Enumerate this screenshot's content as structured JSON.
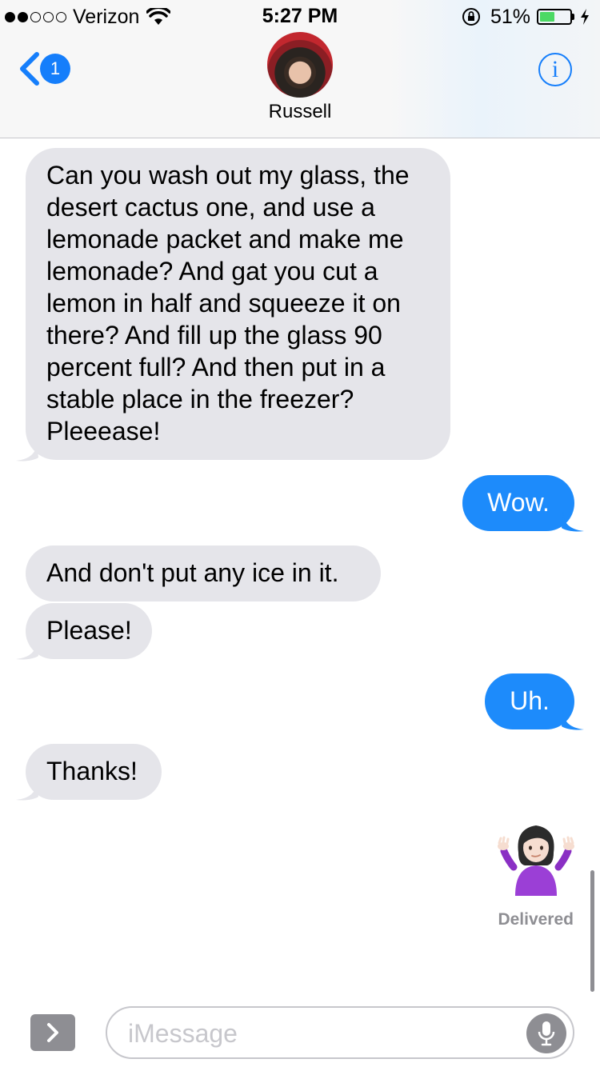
{
  "status_bar": {
    "carrier": "Verizon",
    "signal_bars_filled": 2,
    "signal_bars_total": 5,
    "time": "5:27 PM",
    "battery_percent": "51%",
    "battery_level": 0.51,
    "battery_color": "#4cd964"
  },
  "header": {
    "back_badge_count": "1",
    "contact_name": "Russell",
    "info_icon": "info-icon",
    "accent_color": "#157efb"
  },
  "messages": [
    {
      "direction": "incoming",
      "text": "Can you wash out my glass, the desert cactus one, and use a lemonade packet and make me lemonade? And gat you cut a lemon in half and squeeze it on there? And fill up the glass 90 percent full? And then put in a stable place in the freezer? Pleeease!"
    },
    {
      "direction": "outgoing",
      "text": "Wow."
    },
    {
      "direction": "incoming",
      "text": "And don't put any ice in it."
    },
    {
      "direction": "incoming",
      "text": "Please!"
    },
    {
      "direction": "outgoing",
      "text": "Uh."
    },
    {
      "direction": "incoming",
      "text": "Thanks!"
    },
    {
      "direction": "outgoing",
      "type": "emoji",
      "icon": "person-shrugging-emoji"
    }
  ],
  "delivery_status": "Delivered",
  "composer": {
    "placeholder": "iMessage",
    "apps_icon": "chevron-right-icon",
    "mic_icon": "microphone-icon"
  }
}
